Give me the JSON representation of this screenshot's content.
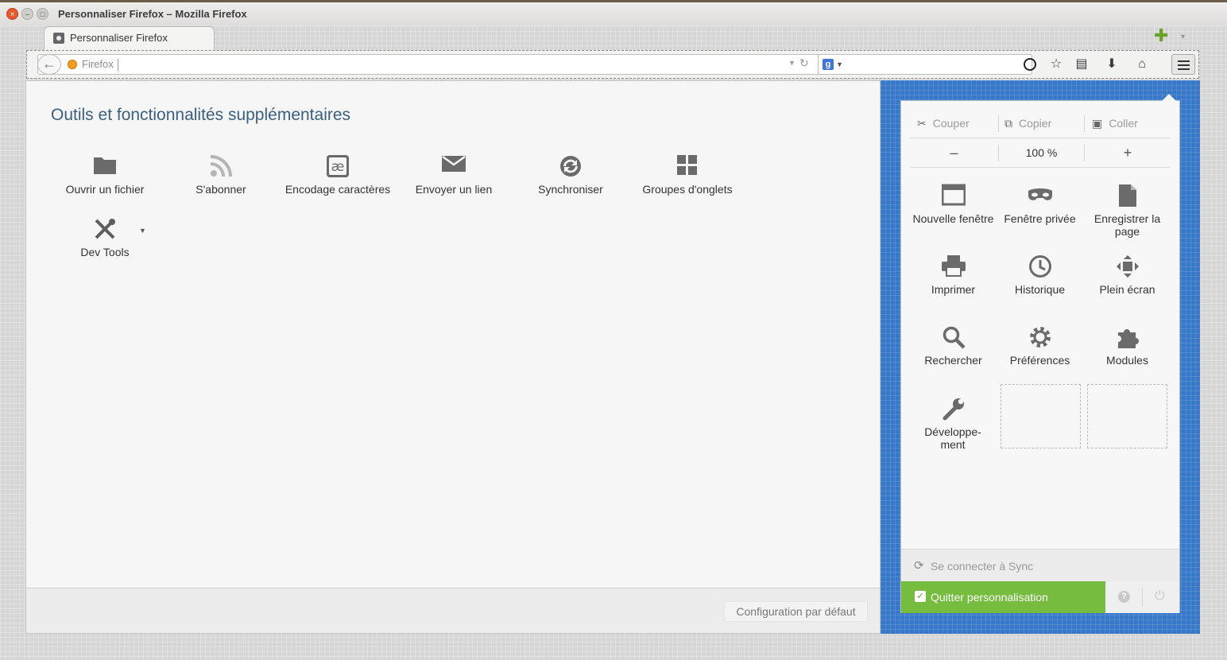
{
  "window": {
    "title": "Personnaliser Firefox – Mozilla Firefox"
  },
  "tab": {
    "label": "Personnaliser Firefox"
  },
  "urlbar": {
    "text": "Firefox"
  },
  "search": {
    "engine_glyph": "g"
  },
  "palette": {
    "title": "Outils et fonctionnalités supplémentaires",
    "items": [
      {
        "label": "Ouvrir un fichier",
        "icon": "folder-icon"
      },
      {
        "label": "S'abonner",
        "icon": "rss-icon"
      },
      {
        "label": "Encodage caractères",
        "icon": "encoding-icon"
      },
      {
        "label": "Envoyer un lien",
        "icon": "envelope-icon"
      },
      {
        "label": "Synchroniser",
        "icon": "sync-icon"
      },
      {
        "label": "Groupes d'onglets",
        "icon": "tab-groups-icon"
      },
      {
        "label": "Dev Tools",
        "icon": "dev-tools-icon"
      }
    ],
    "reset_label": "Configuration par défaut"
  },
  "panel": {
    "edit": {
      "cut": "Couper",
      "copy": "Copier",
      "paste": "Coller"
    },
    "zoom": {
      "minus": "–",
      "level": "100 %",
      "plus": "+"
    },
    "items": [
      {
        "label": "Nouvelle fenêtre",
        "icon": "new-window-icon"
      },
      {
        "label": "Fenêtre privée",
        "icon": "private-mask-icon"
      },
      {
        "label": "Enregistrer la page",
        "icon": "save-page-icon"
      },
      {
        "label": "Imprimer",
        "icon": "printer-icon"
      },
      {
        "label": "Historique",
        "icon": "history-clock-icon"
      },
      {
        "label": "Plein écran",
        "icon": "fullscreen-icon"
      },
      {
        "label": "Rechercher",
        "icon": "search-icon"
      },
      {
        "label": "Préférences",
        "icon": "gear-icon"
      },
      {
        "label": "Modules",
        "icon": "puzzle-icon"
      },
      {
        "label": "Développe-ment",
        "icon": "wrench-icon"
      }
    ],
    "sync_label": "Se connecter à Sync",
    "exit_label": "Quitter personnalisation",
    "help_glyph": "?"
  },
  "colors": {
    "accent_blue": "#3778c8",
    "exit_green": "#76bc3f",
    "title_blue": "#3b5f7e"
  }
}
